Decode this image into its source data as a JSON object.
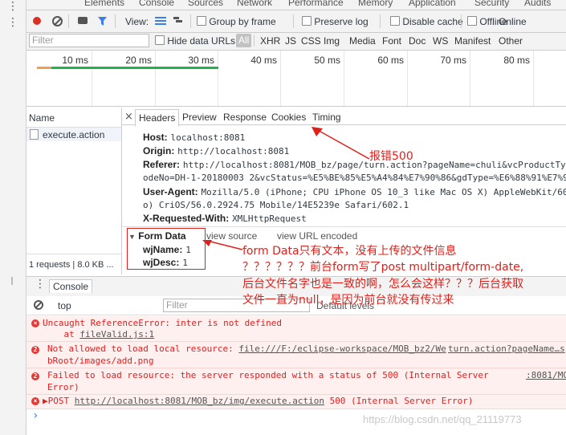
{
  "tabs": [
    "Elements",
    "Console",
    "Sources",
    "Network",
    "Performance",
    "Memory",
    "Application",
    "Security",
    "Audits"
  ],
  "toolbar": {
    "view_label": "View:",
    "group_by_frame": "Group by frame",
    "preserve_log": "Preserve log",
    "disable_cache": "Disable cache",
    "offline": "Offline",
    "online": "Online"
  },
  "filter": {
    "placeholder": "Filter",
    "hide_data_urls": "Hide data URLs",
    "types": [
      "All",
      "XHR",
      "JS",
      "CSS",
      "Img",
      "Media",
      "Font",
      "Doc",
      "WS",
      "Manifest",
      "Other"
    ]
  },
  "timeline": {
    "labels": [
      "10 ms",
      "20 ms",
      "30 ms",
      "40 ms",
      "50 ms",
      "60 ms",
      "70 ms",
      "80 ms"
    ]
  },
  "name_column": {
    "header": "Name",
    "items": [
      "execute.action"
    ],
    "summary": "1 requests | 8.0 KB ..."
  },
  "detail": {
    "tabs": [
      "Headers",
      "Preview",
      "Response",
      "Cookies",
      "Timing"
    ],
    "active_tab": "Headers",
    "headers": [
      {
        "k": "Host:",
        "v": "localhost:8081"
      },
      {
        "k": "Origin:",
        "v": "http://localhost:8081"
      },
      {
        "k": "Referer:",
        "v": "http://localhost:8081/MOB_bz/page/turn.action?pageName=chuli&vcProductTyp"
      },
      {
        "k": "",
        "v": "odeNo=DH-1-20180003 2&vcStatus=%E5%BE%85%E5%A4%84%E7%90%86&gdType=%E6%88%91%E7%9A"
      },
      {
        "k": "User-Agent:",
        "v": "Mozilla/5.0 (iPhone; CPU iPhone OS 10_3 like Mac OS X) AppleWebKit/60"
      },
      {
        "k": "",
        "v": "o) CriOS/56.0.2924.75 Mobile/14E5239e Safari/602.1"
      },
      {
        "k": "X-Requested-With:",
        "v": "XMLHttpRequest"
      }
    ],
    "form_data": {
      "title": "Form Data",
      "view_source": "view source",
      "view_url_encoded": "view URL encoded",
      "fields": [
        {
          "k": "wjName:",
          "v": "1"
        },
        {
          "k": "wjDesc:",
          "v": "1"
        }
      ]
    }
  },
  "console": {
    "tab": "Console",
    "context": "top",
    "filter_placeholder": "Filter",
    "levels": "Default levels",
    "messages": [
      {
        "count": "",
        "line1": "Uncaught ReferenceError: inter is not defined",
        "line2_prefix": "    at ",
        "line2_link": "fileValid.js:1"
      },
      {
        "count": "2",
        "line1": "Not allowed to load local resource: ",
        "link1": "file:///F:/eclipse-workspace/MOB_bz2/We",
        "right_link": "turn.action?pageName…s",
        "line2": "bRoot/images/add.png"
      },
      {
        "count": "2",
        "line1": "Failed to load resource: the server responded with a status of 500 (Internal Server",
        "right_link": ":8081/MO",
        "line2": "Error)"
      },
      {
        "count": "",
        "prefix": "▶POST ",
        "link1": "http://localhost:8081/MOB_bz/img/execute.action",
        "tail": " 500 (Internal Server Error)"
      }
    ],
    "prompt": "›"
  },
  "annotations": {
    "error500": "报错500",
    "line1": "form Data只有文本，没有上传的文件信息",
    "line2": "？？？？？？前台form写了post multipart/form-date,",
    "line3": "后台文件名字也是一致的啊，怎么会这样？？？后台获取",
    "line4": "文件一直为null，是因为前台就没有传过来"
  },
  "watermark": "https://blog.csdn.net/qq_21119773",
  "colors": {
    "accent": "#e0201a",
    "record": "#d93025",
    "dom_line": "#3a7ff0",
    "load_line": "#22b14c"
  }
}
